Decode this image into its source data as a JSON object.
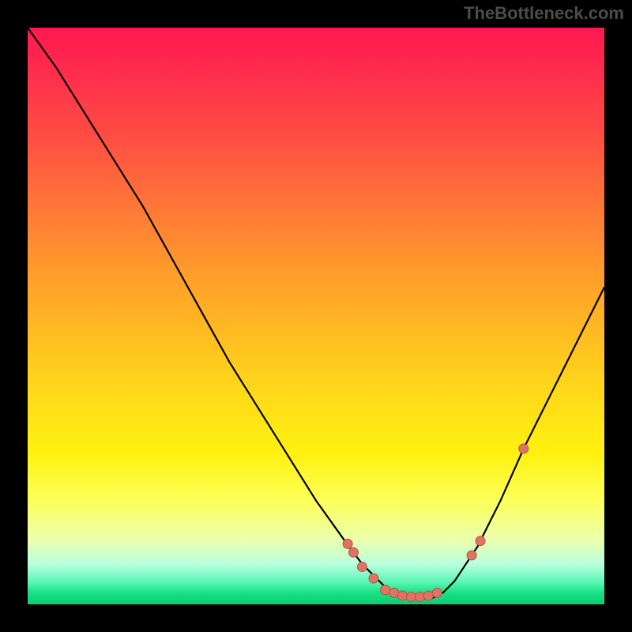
{
  "watermark": "TheBottleneck.com",
  "colors": {
    "curve": "#000000",
    "dot_fill": "#e27363",
    "dot_stroke": "#b5534a"
  },
  "chart_data": {
    "type": "line",
    "title": "",
    "xlabel": "",
    "ylabel": "",
    "xlim": [
      0,
      100
    ],
    "ylim": [
      0,
      100
    ],
    "curve": {
      "x": [
        0,
        5,
        10,
        15,
        20,
        25,
        30,
        35,
        40,
        45,
        50,
        55,
        58,
        60,
        62,
        64,
        66,
        68,
        70,
        72,
        74,
        78,
        82,
        86,
        90,
        94,
        100
      ],
      "y": [
        100,
        93,
        85,
        77,
        69,
        60,
        51,
        42,
        34,
        26,
        18,
        11,
        7,
        5,
        3,
        2,
        1,
        1,
        1,
        2,
        4,
        10,
        18,
        27,
        35,
        43,
        55
      ]
    },
    "dots": {
      "x": [
        55.5,
        56.5,
        58.0,
        60.0,
        62.0,
        63.5,
        65.0,
        66.5,
        68.0,
        69.5,
        71.0,
        77.0,
        78.5,
        86.0
      ],
      "y": [
        10.5,
        9.0,
        6.5,
        4.5,
        2.5,
        2.0,
        1.5,
        1.3,
        1.3,
        1.5,
        2.0,
        8.5,
        11.0,
        27.0
      ]
    }
  }
}
